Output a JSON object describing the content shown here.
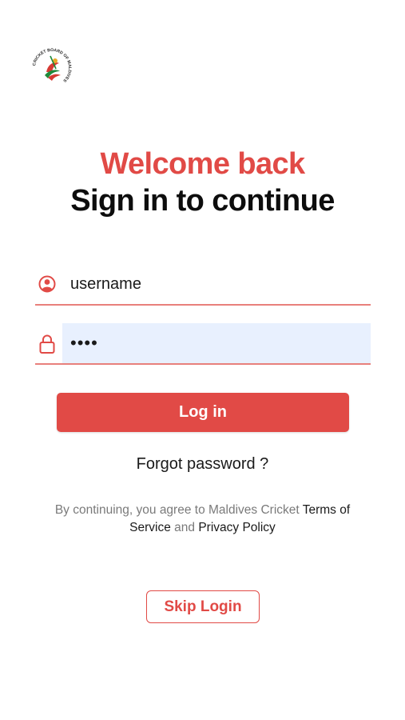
{
  "logo": {
    "alt": "Cricket Board of Maldives",
    "ring_text": "CRICKET BOARD OF MALDIVES",
    "colors": {
      "red": "#d63a33",
      "green": "#1f8a3a",
      "gold": "#e7a928"
    }
  },
  "header": {
    "welcome": "Welcome back",
    "subtitle": "Sign in to continue"
  },
  "form": {
    "username": {
      "value": "username",
      "icon": "user-circle-icon"
    },
    "password": {
      "value": "••••",
      "icon": "lock-icon"
    }
  },
  "actions": {
    "login_label": "Log in",
    "forgot_label": "Forgot password ?",
    "skip_label": "Skip Login"
  },
  "terms": {
    "prefix": "By continuing, you agree to Maldives Cricket ",
    "terms_link": "Terms of Service",
    "and": " and ",
    "privacy_link": "Privacy Policy"
  },
  "theme": {
    "accent": "#e14a46",
    "input_highlight": "#e8f0fe",
    "underline": "#e8807c"
  }
}
